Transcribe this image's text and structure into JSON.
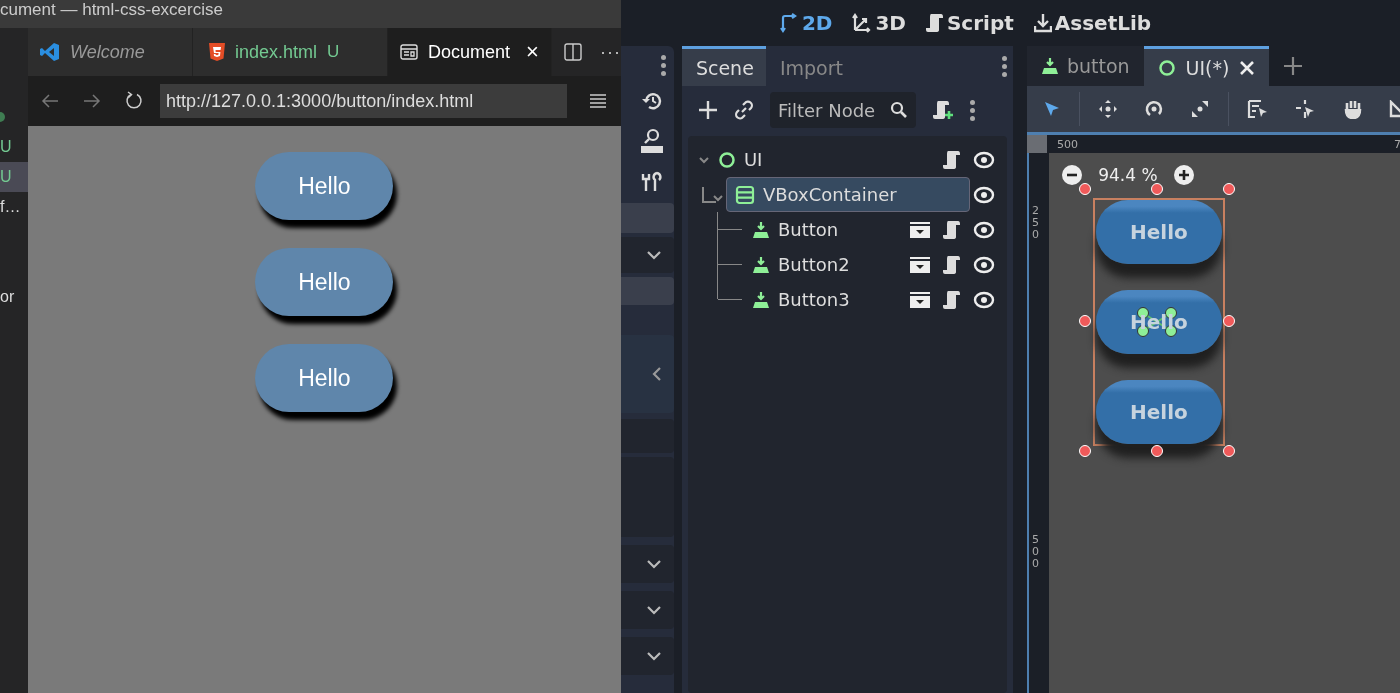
{
  "vscode": {
    "window_title": "cument — html-css-excercise",
    "explorer_fragments": [
      {
        "text": "U",
        "kind": "status",
        "selected": false
      },
      {
        "text": "U",
        "kind": "status",
        "selected": true
      },
      {
        "text": "f…",
        "kind": "name",
        "selected": false
      },
      {
        "text": "or",
        "kind": "name",
        "selected": false
      }
    ],
    "tabs": [
      {
        "label": "Welcome",
        "kind": "welcome",
        "selected": false
      },
      {
        "label": "index.html",
        "badge": "U",
        "kind": "html",
        "selected": false
      },
      {
        "label": "Document",
        "kind": "preview",
        "selected": true,
        "close": "×"
      }
    ],
    "more": "···",
    "url": "http://127.0.0.1:3000/button/index.html",
    "page_buttons": [
      "Hello",
      "Hello",
      "Hello"
    ]
  },
  "godot": {
    "main_screens": [
      {
        "label": "2D",
        "kind": "planar",
        "selected": true
      },
      {
        "label": "3D",
        "kind": "spatial",
        "selected": false
      },
      {
        "label": "Script",
        "kind": "script",
        "selected": false
      },
      {
        "label": "AssetLib",
        "kind": "assetlib",
        "selected": false
      }
    ],
    "dock_tabs": [
      {
        "label": "Scene",
        "selected": true
      },
      {
        "label": "Import",
        "selected": false
      }
    ],
    "filter": {
      "placeholder": "Filter Node"
    },
    "tree": [
      {
        "name": "UI",
        "kind": "control",
        "selected": false,
        "expanded": true,
        "instance": false,
        "script": true,
        "visible": true,
        "children": [
          {
            "name": "VBoxContainer",
            "kind": "vbox",
            "selected": true,
            "expanded": true,
            "instance": false,
            "script": false,
            "visible": true,
            "children": [
              {
                "name": "Button",
                "kind": "button",
                "selected": false,
                "instance": true,
                "script": true,
                "visible": true
              },
              {
                "name": "Button2",
                "kind": "button",
                "selected": false,
                "instance": true,
                "script": true,
                "visible": true
              },
              {
                "name": "Button3",
                "kind": "button",
                "selected": false,
                "instance": true,
                "script": true,
                "visible": true
              }
            ]
          }
        ]
      }
    ],
    "editor_tabs": [
      {
        "label": "button",
        "kind": "button",
        "selected": false
      },
      {
        "label": "UI(*)",
        "kind": "control",
        "selected": true
      }
    ],
    "rulers": {
      "horizontal": [
        "500",
        "7"
      ],
      "vertical": [
        "250",
        "500"
      ]
    },
    "zoom": "94.4 %",
    "canvas_buttons": [
      "Hello",
      "Hello",
      "Hello"
    ]
  }
}
